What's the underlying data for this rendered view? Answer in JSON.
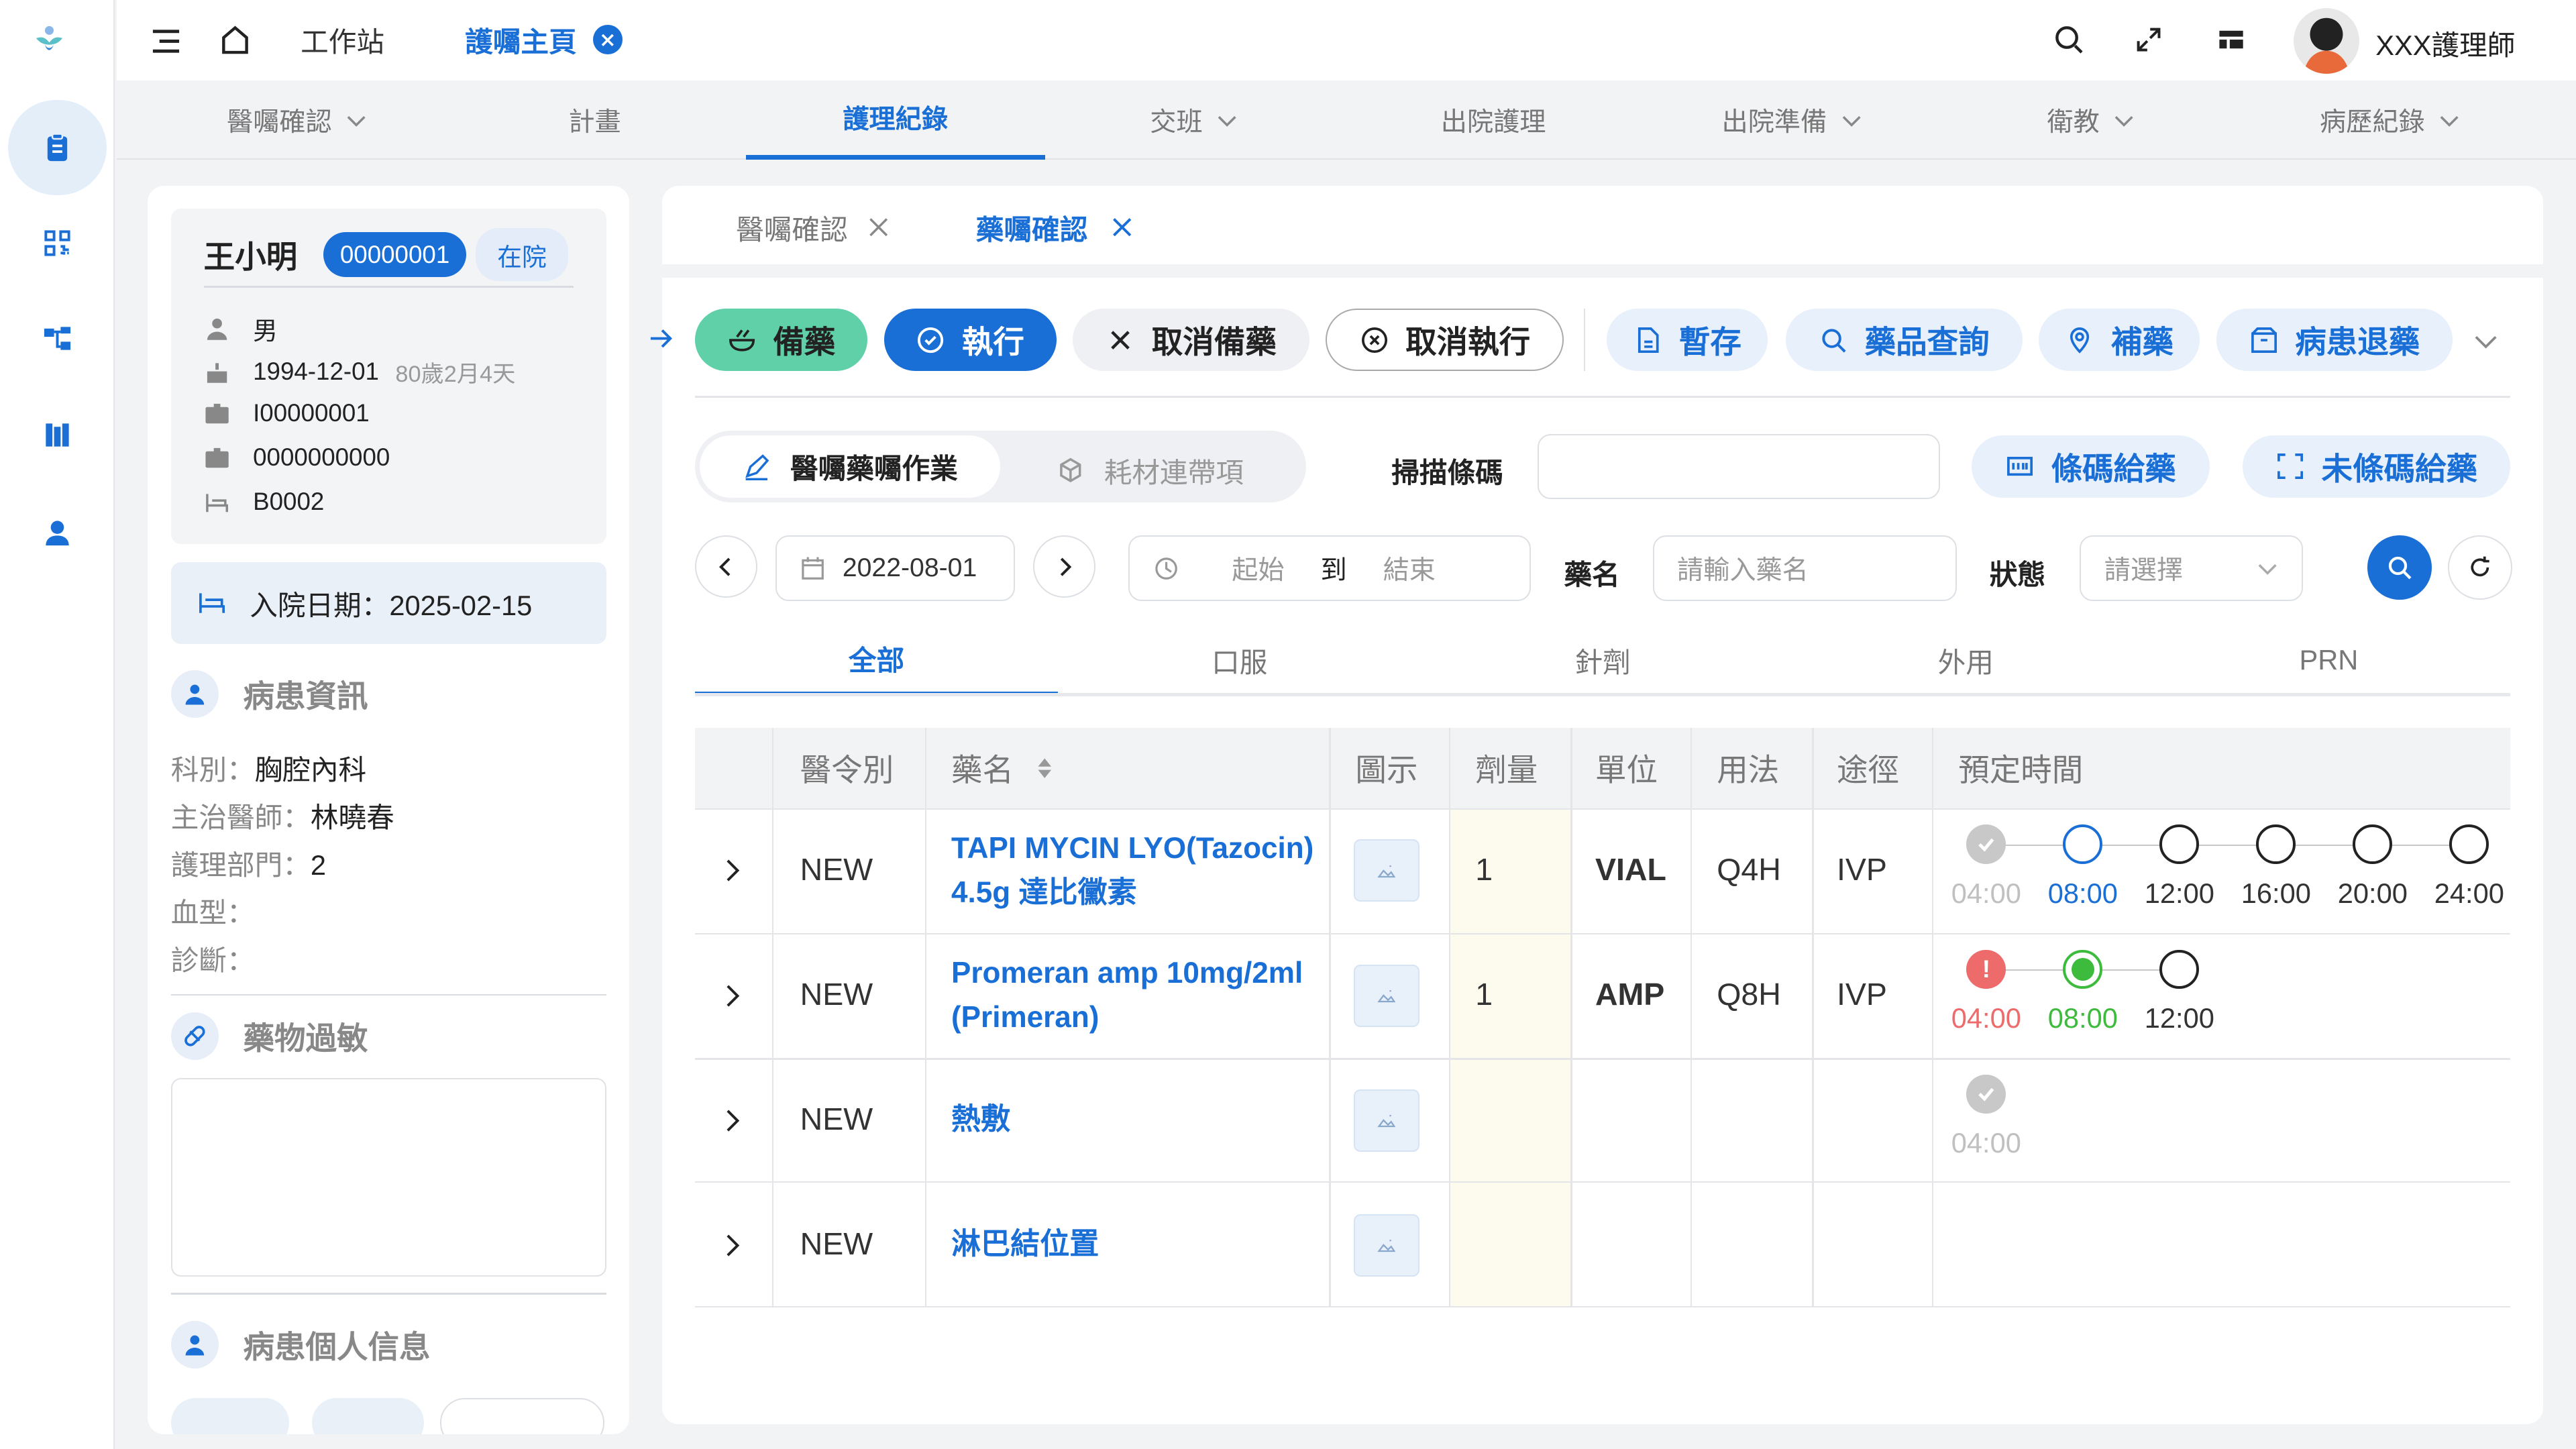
{
  "topbar": {
    "workstation": "工作站",
    "tab_active": "護囑主頁",
    "user": "XXX護理師"
  },
  "nav": [
    "醫囑確認",
    "計畫",
    "護理紀錄",
    "交班",
    "出院護理",
    "出院準備",
    "衛教",
    "病歷紀錄"
  ],
  "patient": {
    "name": "王小明",
    "id": "00000001",
    "status": "在院",
    "gender": "男",
    "dob": "1994-12-01",
    "age": "80歲2月4天",
    "id_no": "I00000001",
    "card_no": "0000000000",
    "bed": "B0002",
    "admit": "入院日期：2025-02-15"
  },
  "sections": {
    "info": "病患資訊",
    "allergy": "藥物過敏",
    "personal": "病患個人信息"
  },
  "info": {
    "dept": "科別：",
    "dept_val": "胸腔內科",
    "doctor": "主治醫師：",
    "doctor_val": "林曉春",
    "unit": "護理部門：",
    "unit_val": "2",
    "blood": "血型：",
    "diag": "診斷："
  },
  "subtabs": [
    "醫囑確認",
    "藥囑確認"
  ],
  "actions": {
    "prep": "備藥",
    "exec": "執行",
    "cancel_prep": "取消備藥",
    "cancel_exec": "取消執行",
    "save": "暫存",
    "lookup": "藥品查詢",
    "supply": "補藥",
    "return": "病患退藥"
  },
  "mode": {
    "tab1": "醫囑藥囑作業",
    "tab2": "耗材連帶項",
    "scan_label": "掃描條碼",
    "barcode_btn": "條碼給藥",
    "nobarcode_btn": "未條碼給藥"
  },
  "filter": {
    "date": "2022-08-01",
    "start": "起始",
    "to": "到",
    "end": "結束",
    "drug_label": "藥名",
    "drug_placeholder": "請輸入藥名",
    "status_label": "狀態",
    "status_placeholder": "請選擇"
  },
  "tabs": [
    "全部",
    "口服",
    "針劑",
    "外用",
    "PRN"
  ],
  "table": {
    "headers": [
      "醫令別",
      "藥名",
      "圖示",
      "劑量",
      "單位",
      "用法",
      "途徑",
      "預定時間"
    ],
    "rows": [
      {
        "type": "NEW",
        "drug1": "TAPI MYCIN LYO(Tazocin)",
        "drug2": "4.5g 達比黴素",
        "dose": "1",
        "unit": "VIAL",
        "usage": "Q4H",
        "route": "IVP",
        "times": [
          {
            "t": "04:00",
            "s": "done"
          },
          {
            "t": "08:00",
            "s": "current"
          },
          {
            "t": "12:00",
            "s": "pending"
          },
          {
            "t": "16:00",
            "s": "pending"
          },
          {
            "t": "20:00",
            "s": "pending"
          },
          {
            "t": "24:00",
            "s": "pending"
          }
        ]
      },
      {
        "type": "NEW",
        "drug1": "Promeran amp 10mg/2ml",
        "drug2": "(Primeran)",
        "dose": "1",
        "unit": "AMP",
        "usage": "Q8H",
        "route": "IVP",
        "times": [
          {
            "t": "04:00",
            "s": "missed"
          },
          {
            "t": "08:00",
            "s": "given"
          },
          {
            "t": "12:00",
            "s": "pending"
          }
        ]
      },
      {
        "type": "NEW",
        "drug1": "熱敷",
        "drug2": "",
        "dose": "",
        "unit": "",
        "usage": "",
        "route": "",
        "times": [
          {
            "t": "04:00",
            "s": "done"
          }
        ]
      },
      {
        "type": "NEW",
        "drug1": "淋巴結位置",
        "drug2": "",
        "dose": "",
        "unit": "",
        "usage": "",
        "route": "",
        "times": []
      }
    ]
  },
  "colors": {
    "primary": "#1a6fd6",
    "prep": "#5fd0a8",
    "red": "#ee6b6b",
    "green": "#3dbb3d",
    "grey": "#c8c8c8"
  }
}
